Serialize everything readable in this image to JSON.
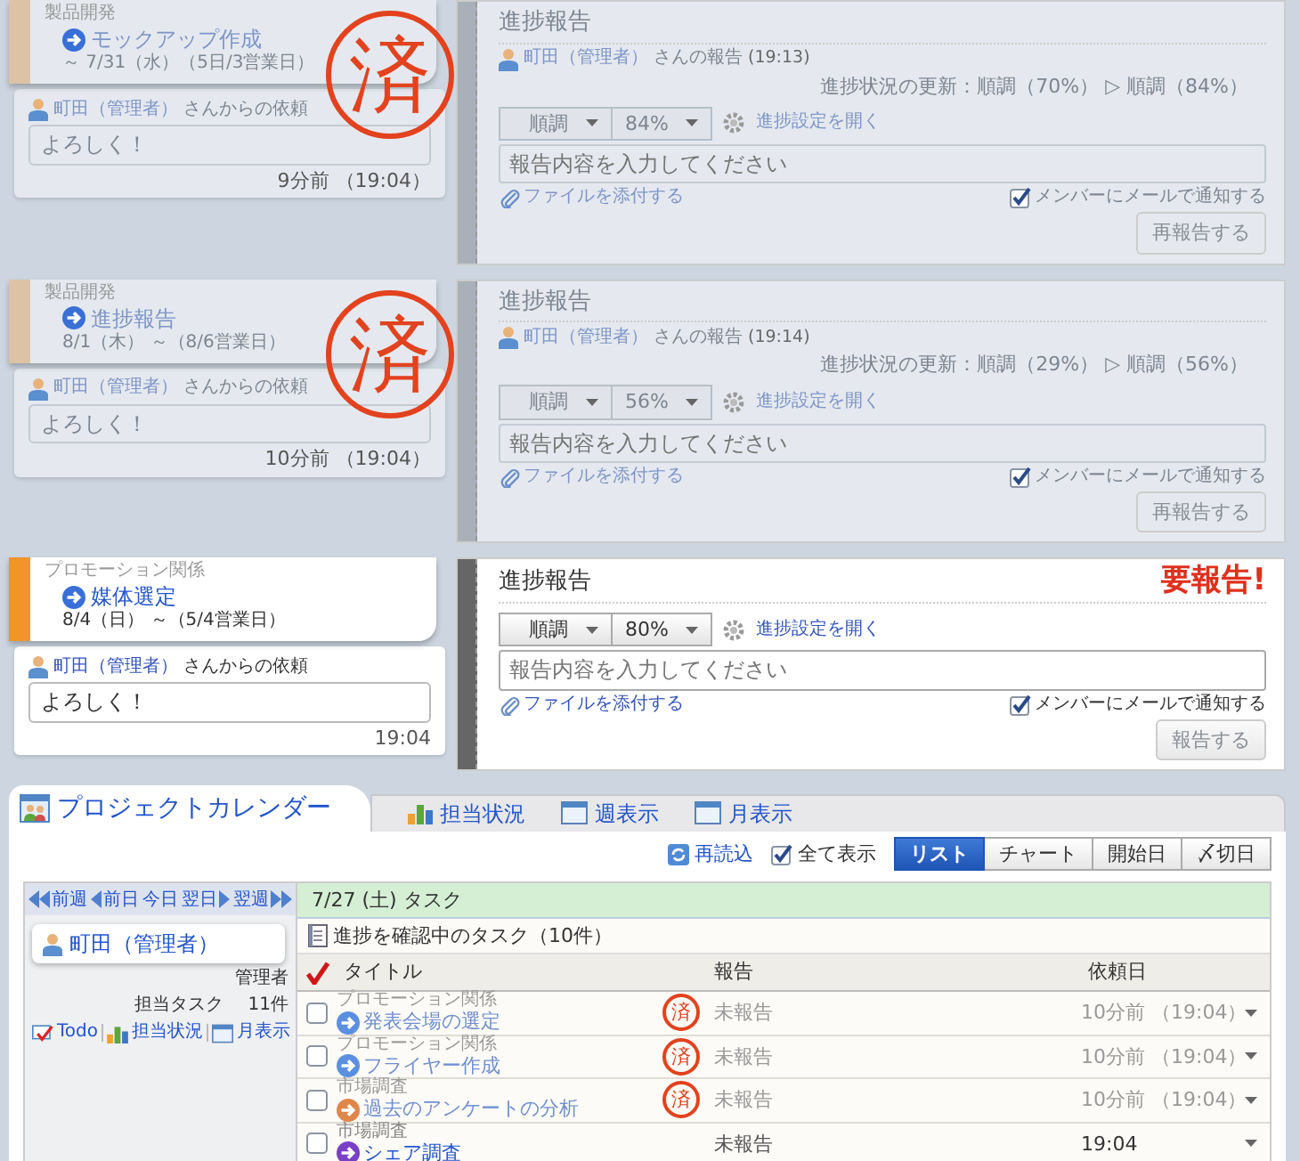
{
  "reports": [
    {
      "done": true,
      "stamp": "済",
      "task": {
        "category": "製品開発",
        "title": "モックアップ作成",
        "dates": "～ 7/31（水）（5日/3営業日）",
        "color": "#dcc3a5"
      },
      "request": {
        "user": "町田（管理者）",
        "text": "さんからの依頼",
        "message": "よろしく！",
        "time": "9分前 （19:04）"
      },
      "panel": {
        "title": "進捗報告",
        "history": {
          "user": "町田（管理者）",
          "text": "さんの報告",
          "time": "(19:13)",
          "update": "進捗状況の更新：順調（70%） ▷ 順調（84%）"
        },
        "status": "順調",
        "percent": "84%",
        "settings": "進捗設定を開く",
        "placeholder": "報告内容を入力してください",
        "attach": "ファイルを添付する",
        "notify": {
          "label": "メンバーにメールで通知する",
          "checked": true
        },
        "button": {
          "label": "再報告する",
          "disabled": true
        }
      }
    },
    {
      "done": true,
      "stamp": "済",
      "task": {
        "category": "製品開発",
        "title": "進捗報告",
        "dates": "8/1（木） ～（8/6営業日）",
        "color": "#dcc3a5"
      },
      "request": {
        "user": "町田（管理者）",
        "text": "さんからの依頼",
        "message": "よろしく！",
        "time": "10分前 （19:04）"
      },
      "panel": {
        "title": "進捗報告",
        "history": {
          "user": "町田（管理者）",
          "text": "さんの報告",
          "time": "(19:14)",
          "update": "進捗状況の更新：順調（29%） ▷ 順調（56%）"
        },
        "status": "順調",
        "percent": "56%",
        "settings": "進捗設定を開く",
        "placeholder": "報告内容を入力してください",
        "attach": "ファイルを添付する",
        "notify": {
          "label": "メンバーにメールで通知する",
          "checked": true
        },
        "button": {
          "label": "再報告する",
          "disabled": true
        }
      }
    },
    {
      "done": false,
      "task": {
        "category": "プロモーション関係",
        "title": "媒体選定",
        "dates": "8/4（日） ～（5/4営業日）",
        "color": "#f0952a"
      },
      "request": {
        "user": "町田（管理者）",
        "text": "さんからの依頼",
        "message": "よろしく！",
        "time": "19:04"
      },
      "panel": {
        "title": "進捗報告",
        "alert": "要報告!",
        "status": "順調",
        "percent": "80%",
        "settings": "進捗設定を開く",
        "placeholder": "報告内容を入力してください",
        "attach": "ファイルを添付する",
        "notify": {
          "label": "メンバーにメールで通知する",
          "checked": true
        },
        "button": {
          "label": "報告する",
          "disabled": true
        }
      }
    }
  ],
  "calendar": {
    "tabs": [
      {
        "label": "プロジェクトカレンダー",
        "selected": true
      },
      {
        "label": "担当状況",
        "selected": false
      },
      {
        "label": "週表示",
        "selected": false
      },
      {
        "label": "月表示",
        "selected": false
      }
    ],
    "toolbar": {
      "reload": "再読込",
      "show_all": {
        "label": "全て表示",
        "checked": true
      },
      "views": [
        {
          "label": "リスト",
          "selected": true
        },
        {
          "label": "チャート",
          "selected": false
        },
        {
          "label": "開始日",
          "selected": false
        },
        {
          "label": "〆切日",
          "selected": false
        }
      ]
    },
    "nav": [
      {
        "label": "前週",
        "kind": "prev2"
      },
      {
        "label": "前日",
        "kind": "prev"
      },
      {
        "label": "今日",
        "kind": "today"
      },
      {
        "label": "翌日",
        "kind": "next"
      },
      {
        "label": "翌週",
        "kind": "next2"
      }
    ],
    "user": {
      "name": "町田（管理者）",
      "role": "管理者",
      "tasks_label": "担当タスク",
      "tasks_count": "11件",
      "links": [
        "Todo",
        "担当状況",
        "月表示"
      ]
    },
    "date_header": "7/27 (土) タスク",
    "section": "進捗を確認中のタスク（10件）",
    "columns": [
      "タイトル",
      "報告",
      "依頼日"
    ],
    "rows": [
      {
        "category": "プロモーション関係",
        "title": "発表会場の選定",
        "color": "#5b8fe0",
        "done": true,
        "stamp": "済",
        "checked": false,
        "report": "未報告",
        "date": "10分前 （19:04）"
      },
      {
        "category": "プロモーション関係",
        "title": "フライヤー作成",
        "color": "#5b8fe0",
        "done": true,
        "stamp": "済",
        "checked": false,
        "report": "未報告",
        "date": "10分前 （19:04）"
      },
      {
        "category": "市場調査",
        "title": "過去のアンケートの分析",
        "color": "#e0864a",
        "done": true,
        "stamp": "済",
        "checked": false,
        "report": "未報告",
        "date": "10分前 （19:04）"
      },
      {
        "category": "市場調査",
        "title": "シェア調査",
        "color": "#7a3fc8",
        "done": false,
        "checked": false,
        "report": "未報告",
        "date": "19:04"
      }
    ]
  }
}
